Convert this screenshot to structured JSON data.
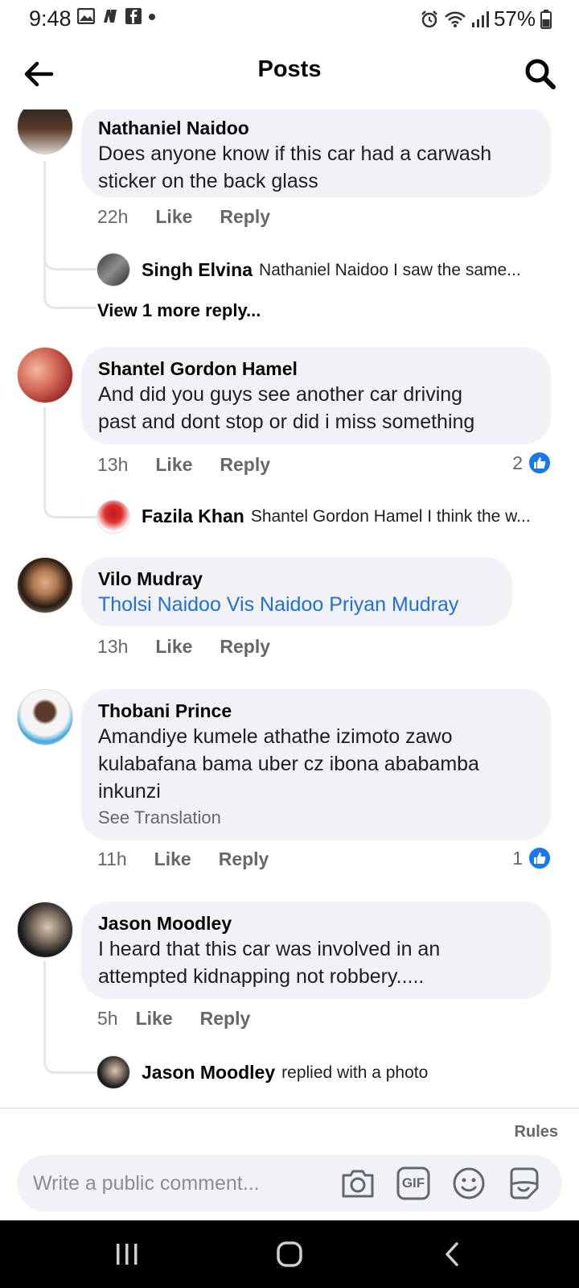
{
  "status_bar": {
    "time": "9:48",
    "battery": "57%"
  },
  "header": {
    "title": "Posts"
  },
  "comments": [
    {
      "name": "Nathaniel Naidoo",
      "lines": [
        "Does anyone know if this car had a carwash",
        "sticker on the back glass"
      ],
      "time": "22h",
      "like": "Like",
      "reply": "Reply",
      "replies": [
        {
          "name": "Singh Elvina",
          "text": "Nathaniel Naidoo I saw the same..."
        }
      ],
      "view_more": "View 1 more reply..."
    },
    {
      "name": "Shantel Gordon Hamel",
      "lines": [
        "And did you guys see another car driving",
        "past and dont stop or did i miss something"
      ],
      "time": "13h",
      "like": "Like",
      "reply": "Reply",
      "reactions": "2",
      "replies": [
        {
          "name": "Fazila Khan",
          "text": "Shantel Gordon Hamel I think the w..."
        }
      ]
    },
    {
      "name": "Vilo Mudray",
      "tags": "Tholsi Naidoo Vis Naidoo Priyan Mudray",
      "time": "13h",
      "like": "Like",
      "reply": "Reply"
    },
    {
      "name": "Thobani Prince",
      "lines": [
        "Amandiye kumele athathe izimoto zawo",
        "kulabafana bama uber cz ibona ababamba",
        "inkunzi"
      ],
      "see_translation": "See Translation",
      "time": "11h",
      "like": "Like",
      "reply": "Reply",
      "reactions": "1"
    },
    {
      "name": "Jason Moodley",
      "lines": [
        "I heard that this car was involved in an",
        "attempted kidnapping not robbery....."
      ],
      "time": "5h",
      "like": "Like",
      "reply": "Reply",
      "replies": [
        {
          "name": "Jason Moodley",
          "text": "replied with a photo"
        }
      ]
    }
  ],
  "footer": {
    "rules": "Rules",
    "placeholder": "Write a public comment...",
    "gif_label": "GIF"
  },
  "colors": {
    "link": "#216fdb",
    "like_blue": "#1877f2",
    "bubble": "#f0f2f5",
    "muted": "#65676b"
  },
  "icons": [
    "back-arrow-icon",
    "search-icon",
    "thumbs-up-icon",
    "camera-icon",
    "gif-icon",
    "emoji-icon",
    "sticker-icon"
  ]
}
